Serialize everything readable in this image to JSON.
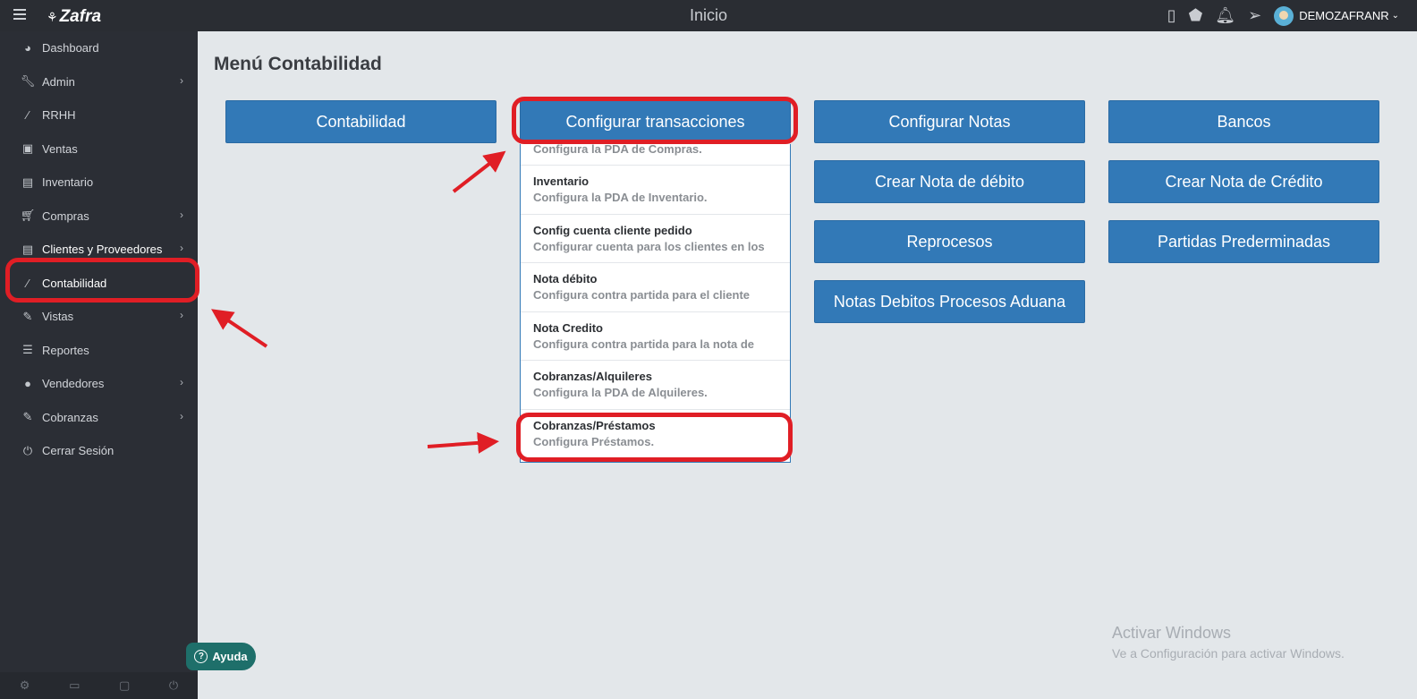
{
  "topbar": {
    "brand": "Zafra",
    "title": "Inicio",
    "user": "DEMOZAFRANR"
  },
  "sidebar": {
    "items": [
      {
        "label": "Dashboard",
        "icon": "tachometer-icon"
      },
      {
        "label": "Admin",
        "icon": "wrench-icon"
      },
      {
        "label": "RRHH",
        "icon": "paperclip-icon"
      },
      {
        "label": "Ventas",
        "icon": "money-icon"
      },
      {
        "label": "Inventario",
        "icon": "book-icon"
      },
      {
        "label": "Compras",
        "icon": "cart-icon"
      },
      {
        "label": "Clientes y Proveedores",
        "icon": "book-icon"
      },
      {
        "label": "Contabilidad",
        "icon": "paperclip-icon"
      },
      {
        "label": "Vistas",
        "icon": "edit-icon"
      },
      {
        "label": "Reportes",
        "icon": "list-icon"
      },
      {
        "label": "Vendedores",
        "icon": "user-icon"
      },
      {
        "label": "Cobranzas",
        "icon": "edit-icon"
      },
      {
        "label": "Cerrar Sesión",
        "icon": "power-icon"
      }
    ],
    "help_label": "Ayuda"
  },
  "main": {
    "title": "Menú Contabilidad",
    "buttons": {
      "contabilidad": "Contabilidad",
      "configurar_transacciones": "Configurar transacciones",
      "configurar_notas": "Configurar Notas",
      "bancos": "Bancos",
      "crear_nota_debito": "Crear Nota de débito",
      "crear_nota_credito": "Crear Nota de Crédito",
      "reprocesos": "Reprocesos",
      "partidas_predeterminadas": "Partidas Prederminadas",
      "notas_debitos_aduana": "Notas Debitos Procesos Aduana"
    },
    "dropdown": [
      {
        "title": "",
        "desc": "Configura la PDA de Compras."
      },
      {
        "title": "Inventario",
        "desc": "Configura la PDA de Inventario."
      },
      {
        "title": "Config cuenta cliente pedido",
        "desc": "Configurar cuenta para los clientes en los"
      },
      {
        "title": "Nota débito",
        "desc": "Configura contra partida para el cliente"
      },
      {
        "title": "Nota Credito",
        "desc": "Configura contra partida para la nota de"
      },
      {
        "title": "Cobranzas/Alquileres",
        "desc": "Configura la PDA de Alquileres."
      },
      {
        "title": "Cobranzas/Préstamos",
        "desc": "Configura Préstamos."
      }
    ]
  },
  "watermark": {
    "line1": "Activar Windows",
    "line2": "Ve a Configuración para activar Windows."
  },
  "colors": {
    "primary_button": "#3279b7",
    "sidebar_bg": "#2b2e35",
    "topbar_bg": "#2a2d33",
    "annotation_red": "#e01e25",
    "page_bg": "#e3e7ea"
  }
}
